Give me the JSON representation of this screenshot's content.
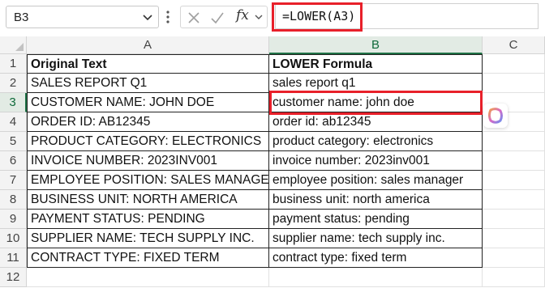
{
  "formula_bar": {
    "name_box": "B3",
    "formula": "=LOWER(A3)",
    "fx_label": "fx"
  },
  "columns": [
    "A",
    "B",
    "C"
  ],
  "rows": [
    "1",
    "2",
    "3",
    "4",
    "5",
    "6",
    "7",
    "8",
    "9",
    "10",
    "11",
    "12"
  ],
  "table": {
    "headers": [
      "Original Text",
      "LOWER Formula"
    ],
    "data": [
      [
        "SALES REPORT Q1",
        "sales report q1"
      ],
      [
        "CUSTOMER NAME: JOHN DOE",
        "customer name: john doe"
      ],
      [
        "ORDER ID: AB12345",
        "order id: ab12345"
      ],
      [
        "PRODUCT CATEGORY: ELECTRONICS",
        "product category: electronics"
      ],
      [
        "INVOICE NUMBER: 2023INV001",
        "invoice number: 2023inv001"
      ],
      [
        "EMPLOYEE POSITION: SALES MANAGER",
        "employee position: sales manager"
      ],
      [
        "BUSINESS UNIT: NORTH AMERICA",
        "business unit: north america"
      ],
      [
        "PAYMENT STATUS: PENDING",
        "payment status: pending"
      ],
      [
        "SUPPLIER NAME: TECH SUPPLY INC.",
        "supplier name: tech supply inc."
      ],
      [
        "CONTRACT TYPE: FIXED TERM",
        "contract type: fixed term"
      ]
    ]
  },
  "selected_cell": "B3",
  "icons": [
    "chevron-down-icon",
    "more-vertical-icon",
    "cancel-x-icon",
    "enter-check-icon",
    "insert-function-icon",
    "copilot-icon"
  ],
  "colors": {
    "highlight": "#e8202a",
    "selection_green": "#1e7145"
  }
}
